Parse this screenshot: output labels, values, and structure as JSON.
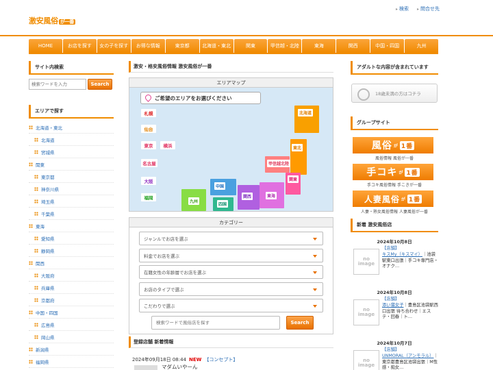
{
  "header": {
    "logo": "激安風俗",
    "logo_suffix": "が一番",
    "top_links": [
      "検索",
      "問合せ先"
    ]
  },
  "nav": [
    "HOME",
    "お店を探す",
    "女の子を探す",
    "お得な情報",
    "東京都",
    "北海道・東北",
    "関東",
    "甲信越・北陸",
    "東海",
    "関西",
    "中国・四国",
    "九州"
  ],
  "left": {
    "search_title": "サイト内検索",
    "search_placeholder": "検索ワードを入力",
    "search_button": "Search",
    "area_title": "エリアで探す",
    "areas": [
      {
        "label": "北海道・東北",
        "sub": false
      },
      {
        "label": "北海道",
        "sub": true
      },
      {
        "label": "宮城県",
        "sub": true
      },
      {
        "label": "関東",
        "sub": false
      },
      {
        "label": "東京都",
        "sub": true
      },
      {
        "label": "神奈川県",
        "sub": true
      },
      {
        "label": "埼玉県",
        "sub": true
      },
      {
        "label": "千葉県",
        "sub": true
      },
      {
        "label": "東海",
        "sub": false
      },
      {
        "label": "愛知県",
        "sub": true
      },
      {
        "label": "静岡県",
        "sub": true
      },
      {
        "label": "関西",
        "sub": false
      },
      {
        "label": "大阪府",
        "sub": true
      },
      {
        "label": "兵庫県",
        "sub": true
      },
      {
        "label": "京都府",
        "sub": true
      },
      {
        "label": "中国・四国",
        "sub": false
      },
      {
        "label": "広島県",
        "sub": true
      },
      {
        "label": "岡山県",
        "sub": true
      },
      {
        "label": "新潟県",
        "sub": false
      },
      {
        "label": "福岡県",
        "sub": false
      }
    ]
  },
  "main": {
    "heading": "激安・格安風俗情報 激安風俗が一番",
    "map_header": "エリアマップ",
    "map_title": "ご希望のエリアをお選びください",
    "cities": [
      "札幌",
      "仙台",
      "東京",
      "横浜",
      "名古屋",
      "大阪",
      "福岡"
    ],
    "regions": [
      "北海道",
      "東北",
      "甲信越北陸",
      "関東",
      "東海",
      "関西",
      "中国",
      "四国",
      "九州"
    ],
    "category_header": "カテゴリー",
    "selects": [
      "ジャンルでお店を選ぶ",
      "料金でお店を選ぶ",
      "在籍女性の年齢層でお店を選ぶ",
      "お店のタイプで選ぶ",
      "こだわりで選ぶ"
    ],
    "keyword_placeholder": "検索ワードで風俗店を探す",
    "keyword_button": "Search",
    "news_heading": "登録店舗 新着情報",
    "news": {
      "date": "2024年09月18日 08:44",
      "badge": "NEW",
      "tag": "【コンセプト】",
      "title": "マダムいやーん"
    }
  },
  "right": {
    "adult_title": "アダルトな内容が含まれています",
    "age_button": "18歳未満の方はコチラ",
    "group_title": "グループサイト",
    "banners": [
      {
        "main": "風俗",
        "ga": "が",
        "ichi": "1番",
        "caption": "風俗情報 風俗が一番"
      },
      {
        "main": "手コキ",
        "ga": "が",
        "ichi": "1番",
        "caption": "手コキ風俗情報 手こきが一番"
      },
      {
        "main": "人妻風俗",
        "ga": "が",
        "ichi": "1番",
        "caption": "人妻・熟女風俗情報 人妻風俗が一番"
      }
    ],
    "shop_title": "新着 激安風俗店",
    "no_image": "no image",
    "shops": [
      {
        "date": "2024年10月8日",
        "tag": "【店舗】",
        "name": "キスMy（キスマイ）",
        "desc": "｜池袋駅東口出張｜手コキ専門店・オナク…"
      },
      {
        "date": "2024年10月8日",
        "tag": "【店舗】",
        "name": "添い寝女子",
        "desc": "｜豊島区池袋駅西口出張 待ち合わせ｜エステ・回春｜ト…"
      },
      {
        "date": "2024年10月7日",
        "tag": "【店舗】",
        "name": "UNMORAL（アンモラル）",
        "desc": "｜東京都豊島区池袋出張｜M性感・痴女…"
      }
    ]
  }
}
